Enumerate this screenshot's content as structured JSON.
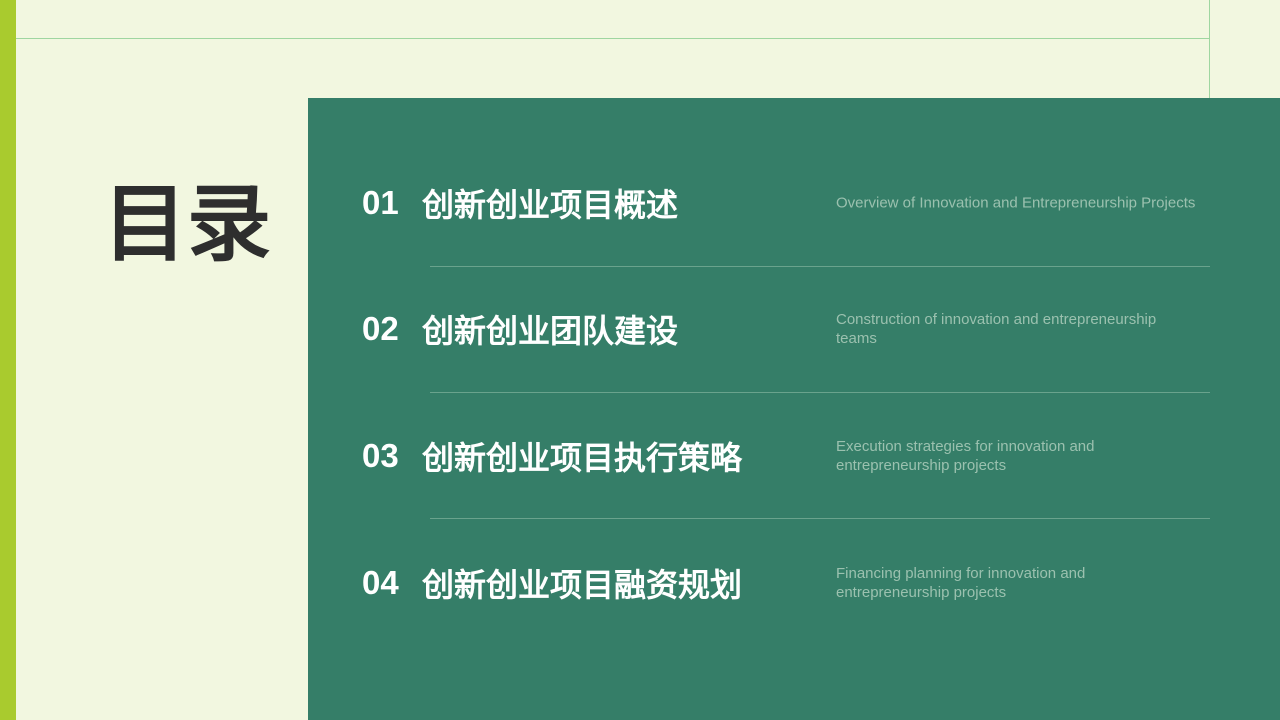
{
  "slide": {
    "title": "目录",
    "colors": {
      "background": "#f2f7e0",
      "accent_bar": "#a9cb2e",
      "panel": "#357e68",
      "line": "#9fd6a0"
    },
    "items": [
      {
        "number": "01",
        "title": "创新创业项目概述",
        "subtitle": "Overview of Innovation and Entrepreneurship Projects"
      },
      {
        "number": "02",
        "title": "创新创业团队建设",
        "subtitle": "Construction of innovation and entrepreneurship teams"
      },
      {
        "number": "03",
        "title": "创新创业项目执行策略",
        "subtitle": "Execution strategies for innovation and entrepreneurship projects"
      },
      {
        "number": "04",
        "title": "创新创业项目融资规划",
        "subtitle": "Financing planning for innovation and entrepreneurship projects"
      }
    ]
  }
}
